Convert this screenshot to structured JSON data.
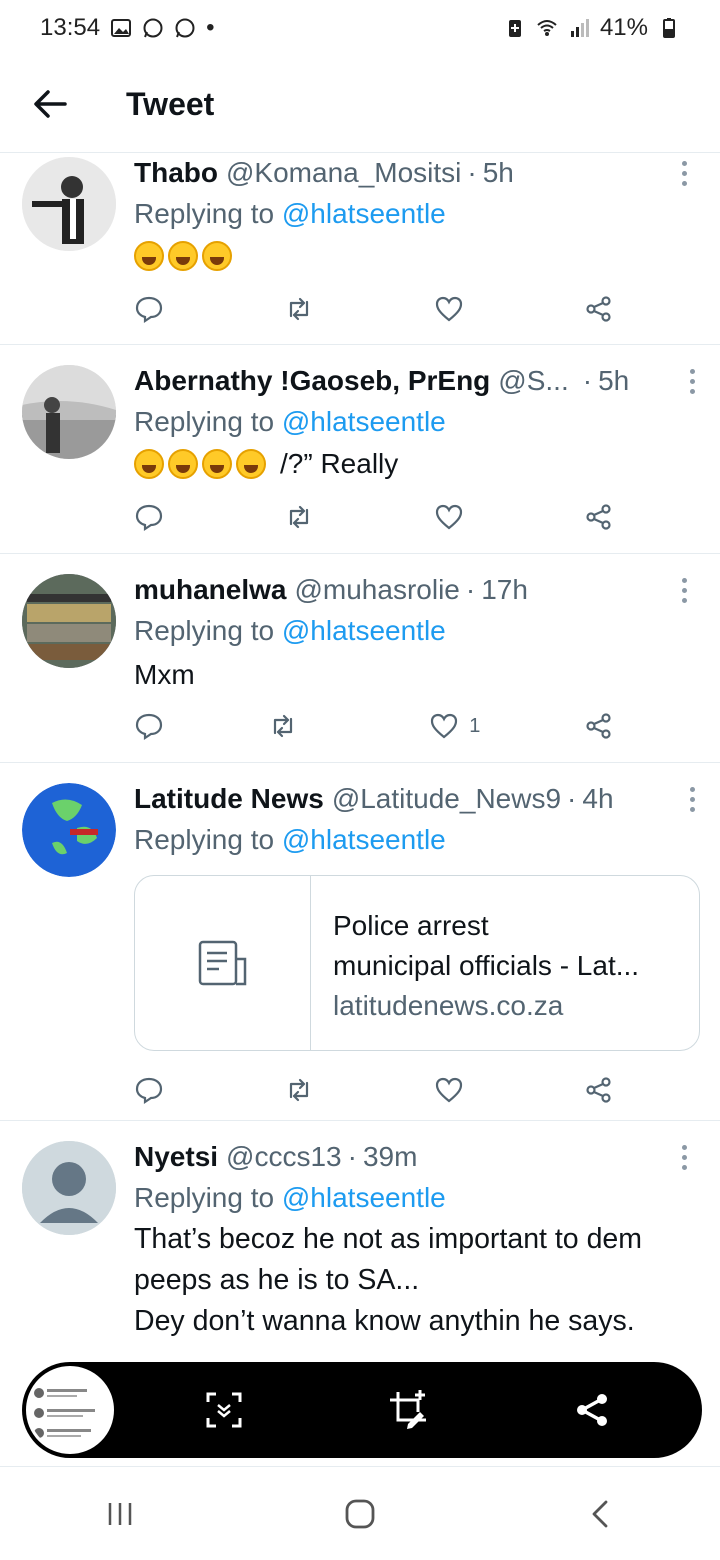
{
  "status_bar": {
    "time": "13:54",
    "battery": "41%",
    "dot": "•"
  },
  "header": {
    "title": "Tweet",
    "back_icon": "arrow-left-icon"
  },
  "tweets": [
    {
      "name": "Thabo",
      "handle": "@Komana_Mositsi",
      "sep": "·",
      "time": "5h",
      "replying_prefix": "Replying to",
      "replying_to": "@hlatseentle",
      "emoji_count": 3,
      "text": "",
      "likes": ""
    },
    {
      "name": "Abernathy !Gaoseb, PrEng",
      "handle": "@S...",
      "sep": "·",
      "time": "5h",
      "replying_prefix": "Replying to",
      "replying_to": "@hlatseentle",
      "emoji_count": 4,
      "text": "/?” Really",
      "likes": ""
    },
    {
      "name": "muhanelwa",
      "handle": "@muhasrolie",
      "sep": "·",
      "time": "17h",
      "replying_prefix": "Replying to",
      "replying_to": "@hlatseentle",
      "emoji_count": 0,
      "text": "Mxm",
      "likes": "1"
    },
    {
      "name": "Latitude News",
      "handle": "@Latitude_News9",
      "sep": "·",
      "time": "4h",
      "replying_prefix": "Replying to",
      "replying_to": "@hlatseentle",
      "card": {
        "title_line1": "Police arrest",
        "title_line2": "municipal officials - Lat...",
        "domain": "latitudenews.co.za"
      },
      "likes": ""
    },
    {
      "name": "Nyetsi",
      "handle": "@cccs13",
      "sep": "·",
      "time": "39m",
      "replying_prefix": "Replying to",
      "replying_to": "@hlatseentle",
      "text_lines": [
        "That’s becoz he not as important to dem",
        "peeps as he is to SA...",
        "Dey don’t wanna know anythin he says."
      ],
      "likes": ""
    }
  ],
  "colors": {
    "link": "#1d9bf0",
    "secondary": "#536471",
    "primary": "#0f1419",
    "divider": "#e6ecf0"
  }
}
